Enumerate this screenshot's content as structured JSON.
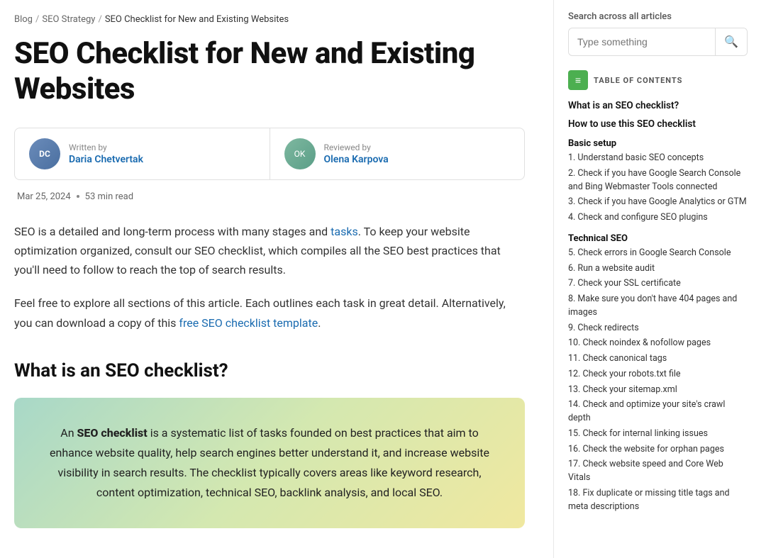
{
  "breadcrumb": {
    "items": [
      "Blog",
      "SEO Strategy",
      "SEO Checklist for New and Existing Websites"
    ],
    "separators": [
      "/",
      "/"
    ]
  },
  "article": {
    "title": "SEO Checklist for New and Existing Websites",
    "author": {
      "written_by_label": "Written by",
      "author_name": "Daria Chetvertak",
      "reviewed_by_label": "Reviewed by",
      "reviewer_name": "Olena Karpova"
    },
    "meta": {
      "date": "Mar 25, 2024",
      "read_time": "53 min read"
    },
    "intro_paragraph_1": "SEO is a detailed and long-term process with many stages and tasks. To keep your website optimization organized, consult our SEO checklist, which compiles all the SEO best practices that you'll need to follow to reach the top of search results.",
    "intro_link_1": "tasks",
    "intro_paragraph_2": "Feel free to explore all sections of this article. Each outlines each task in great detail. Alternatively, you can download a copy of this free SEO checklist template.",
    "intro_link_2": "free SEO checklist template",
    "section_heading": "What is an SEO checklist?",
    "highlight_text_1": "An ",
    "highlight_bold": "SEO checklist",
    "highlight_text_2": " is a systematic list of tasks founded on best practices that aim to enhance website quality, help search engines better understand it, and increase website visibility in search results. The checklist typically covers areas like keyword research, content optimization, technical SEO, backlink analysis, and local SEO."
  },
  "sidebar": {
    "search_label": "Search across all articles",
    "search_placeholder": "Type something",
    "search_button_icon": "🔍",
    "toc_label": "TABLE OF CONTENTS",
    "toc_icon": "≡",
    "sections": [
      {
        "type": "link",
        "label": "What is an SEO checklist?"
      },
      {
        "type": "link",
        "label": "How to use this SEO checklist"
      },
      {
        "type": "group",
        "label": "Basic setup",
        "items": [
          "1. Understand basic SEO concepts",
          "2. Check if you have Google Search Console and Bing Webmaster Tools connected",
          "3. Check if you have Google Analytics or GTM",
          "4. Check and configure SEO plugins"
        ]
      },
      {
        "type": "group",
        "label": "Technical SEO",
        "items": [
          "5. Check errors in Google Search Console",
          "6. Run a website audit",
          "7. Check your SSL certificate",
          "8. Make sure you don't have 404 pages and images",
          "9. Check redirects",
          "10. Check noindex & nofollow pages",
          "11. Check canonical tags",
          "12. Check your robots.txt file",
          "13. Check your sitemap.xml",
          "14. Check and optimize your site's crawl depth",
          "15. Check for internal linking issues",
          "16. Check the website for orphan pages",
          "17. Check website speed and Core Web Vitals",
          "18. Fix duplicate or missing title tags and meta descriptions"
        ]
      }
    ]
  }
}
